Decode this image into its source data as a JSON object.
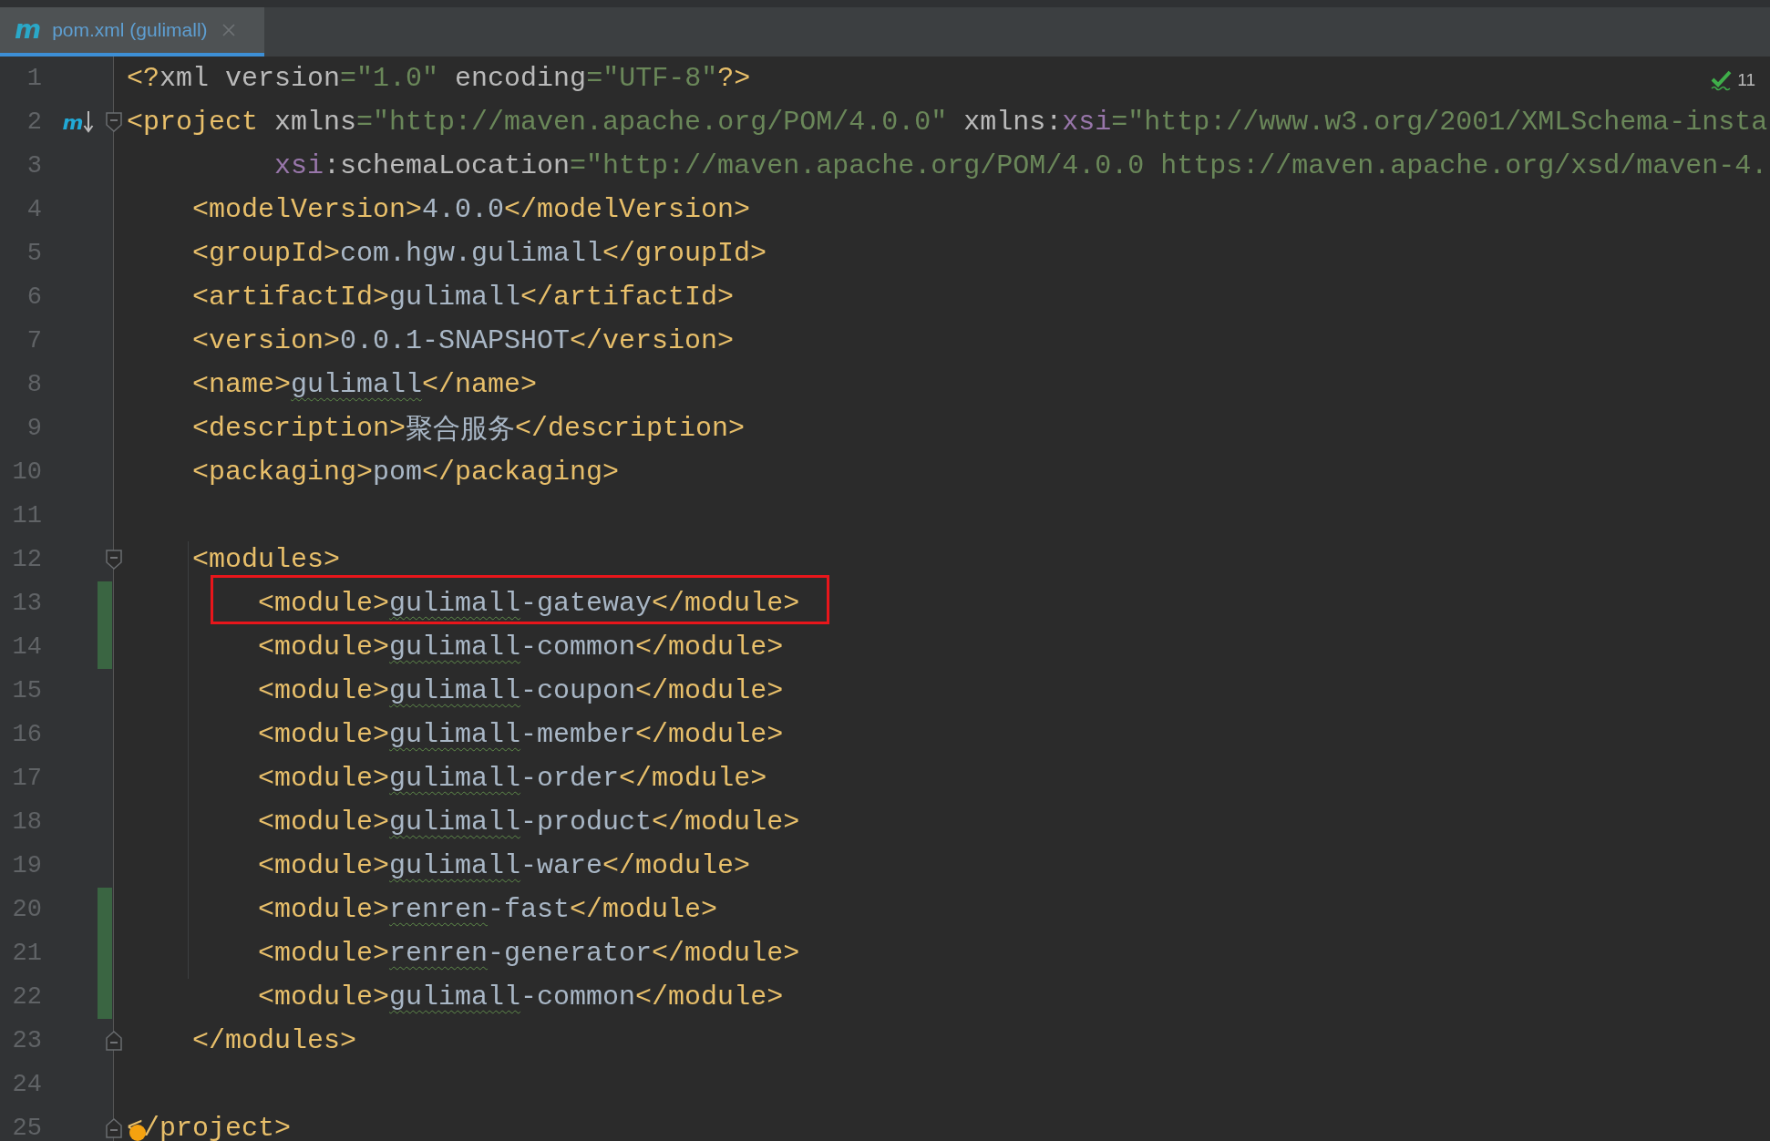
{
  "tab": {
    "icon": "m",
    "label": "pom.xml (gulimall)",
    "selected": true
  },
  "inspections": {
    "count": "11"
  },
  "lines": [
    {
      "number": "1",
      "changed": false,
      "highlighted": false,
      "dot": false,
      "fold_start": false,
      "fold_end": false,
      "tokens": [
        {
          "kind": "tag",
          "text": "<?"
        },
        {
          "kind": "attr",
          "text": "xml version"
        },
        {
          "kind": "value",
          "text": "=\"1.0\""
        },
        {
          "kind": "attr",
          "text": " encoding"
        },
        {
          "kind": "value",
          "text": "=\"UTF-8\""
        },
        {
          "kind": "tag",
          "text": "?>"
        }
      ]
    },
    {
      "number": "2",
      "changed": false,
      "highlighted": false,
      "dot": false,
      "fold_start": true,
      "fold_end": false,
      "gutter_mark": "m",
      "tokens": [
        {
          "kind": "tag",
          "text": "<project"
        },
        {
          "kind": "attr",
          "text": " xmlns"
        },
        {
          "kind": "value",
          "text": "=\"http://maven.apache.org/POM/4.0.0\""
        },
        {
          "kind": "attr",
          "text": " xmlns:"
        },
        {
          "kind": "ns",
          "text": "xsi"
        },
        {
          "kind": "value",
          "text": "=\"http://www.w3.org/2001/XMLSchema-insta"
        }
      ]
    },
    {
      "number": "3",
      "changed": false,
      "highlighted": false,
      "dot": false,
      "fold_start": false,
      "fold_end": false,
      "tokens": [
        {
          "kind": "ns",
          "text": "         xsi"
        },
        {
          "kind": "attr",
          "text": ":schemaLocation"
        },
        {
          "kind": "value",
          "text": "=\"http://maven.apache.org/POM/4.0.0 https://maven.apache.org/xsd/maven-4."
        }
      ]
    },
    {
      "number": "4",
      "changed": false,
      "highlighted": false,
      "dot": false,
      "fold_start": false,
      "fold_end": false,
      "tokens": [
        {
          "kind": "tag",
          "text": "    <modelVersion>"
        },
        {
          "kind": "text",
          "text": "4.0.0"
        },
        {
          "kind": "tag",
          "text": "</modelVersion>"
        }
      ]
    },
    {
      "number": "5",
      "changed": false,
      "highlighted": false,
      "dot": false,
      "fold_start": false,
      "fold_end": false,
      "tokens": [
        {
          "kind": "tag",
          "text": "    <groupId>"
        },
        {
          "kind": "text",
          "text": "com.hgw.gulimall"
        },
        {
          "kind": "tag",
          "text": "</groupId>"
        }
      ]
    },
    {
      "number": "6",
      "changed": false,
      "highlighted": false,
      "dot": false,
      "fold_start": false,
      "fold_end": false,
      "tokens": [
        {
          "kind": "tag",
          "text": "    <artifactId>"
        },
        {
          "kind": "text",
          "text": "gulimall"
        },
        {
          "kind": "tag",
          "text": "</artifactId>"
        }
      ]
    },
    {
      "number": "7",
      "changed": false,
      "highlighted": false,
      "dot": false,
      "fold_start": false,
      "fold_end": false,
      "tokens": [
        {
          "kind": "tag",
          "text": "    <version>"
        },
        {
          "kind": "text",
          "text": "0.0.1-SNAPSHOT"
        },
        {
          "kind": "tag",
          "text": "</version>"
        }
      ]
    },
    {
      "number": "8",
      "changed": false,
      "highlighted": false,
      "dot": false,
      "fold_start": false,
      "fold_end": false,
      "tokens": [
        {
          "kind": "tag",
          "text": "    <name>"
        },
        {
          "kind": "typo",
          "text": "gulimall"
        },
        {
          "kind": "tag",
          "text": "</name>"
        }
      ]
    },
    {
      "number": "9",
      "changed": false,
      "highlighted": false,
      "dot": false,
      "fold_start": false,
      "fold_end": false,
      "tokens": [
        {
          "kind": "tag",
          "text": "    <description>"
        },
        {
          "kind": "text",
          "text": "聚合服务"
        },
        {
          "kind": "tag",
          "text": "</description>"
        }
      ]
    },
    {
      "number": "10",
      "changed": false,
      "highlighted": false,
      "dot": false,
      "fold_start": false,
      "fold_end": false,
      "tokens": [
        {
          "kind": "tag",
          "text": "    <packaging>"
        },
        {
          "kind": "text",
          "text": "pom"
        },
        {
          "kind": "tag",
          "text": "</packaging>"
        }
      ]
    },
    {
      "number": "11",
      "changed": false,
      "highlighted": false,
      "dot": false,
      "fold_start": false,
      "fold_end": false
    },
    {
      "number": "12",
      "changed": false,
      "highlighted": false,
      "dot": false,
      "fold_start": true,
      "fold_end": false,
      "tokens": [
        {
          "kind": "tag",
          "text": "    <modules>"
        }
      ]
    },
    {
      "number": "13",
      "changed": true,
      "highlighted": true,
      "dot": false,
      "fold_start": false,
      "fold_end": false,
      "tokens": [
        {
          "kind": "tag",
          "text": "        <module>"
        },
        {
          "kind": "typo",
          "text": "gulimall"
        },
        {
          "kind": "text",
          "text": "-gateway"
        },
        {
          "kind": "tag",
          "text": "</module>"
        }
      ]
    },
    {
      "number": "14",
      "changed": true,
      "highlighted": false,
      "dot": false,
      "fold_start": false,
      "fold_end": false,
      "tokens": [
        {
          "kind": "tag",
          "text": "        <module>"
        },
        {
          "kind": "typo",
          "text": "gulimall"
        },
        {
          "kind": "text",
          "text": "-common"
        },
        {
          "kind": "tag",
          "text": "</module>"
        }
      ]
    },
    {
      "number": "15",
      "changed": false,
      "highlighted": false,
      "dot": false,
      "fold_start": false,
      "fold_end": false,
      "tokens": [
        {
          "kind": "tag",
          "text": "        <module>"
        },
        {
          "kind": "typo",
          "text": "gulimall"
        },
        {
          "kind": "text",
          "text": "-coupon"
        },
        {
          "kind": "tag",
          "text": "</module>"
        }
      ]
    },
    {
      "number": "16",
      "changed": false,
      "highlighted": false,
      "dot": false,
      "fold_start": false,
      "fold_end": false,
      "tokens": [
        {
          "kind": "tag",
          "text": "        <module>"
        },
        {
          "kind": "typo",
          "text": "gulimall"
        },
        {
          "kind": "text",
          "text": "-member"
        },
        {
          "kind": "tag",
          "text": "</module>"
        }
      ]
    },
    {
      "number": "17",
      "changed": false,
      "highlighted": false,
      "dot": false,
      "fold_start": false,
      "fold_end": false,
      "tokens": [
        {
          "kind": "tag",
          "text": "        <module>"
        },
        {
          "kind": "typo",
          "text": "gulimall"
        },
        {
          "kind": "text",
          "text": "-order"
        },
        {
          "kind": "tag",
          "text": "</module>"
        }
      ]
    },
    {
      "number": "18",
      "changed": false,
      "highlighted": false,
      "dot": false,
      "fold_start": false,
      "fold_end": false,
      "tokens": [
        {
          "kind": "tag",
          "text": "        <module>"
        },
        {
          "kind": "typo",
          "text": "gulimall"
        },
        {
          "kind": "text",
          "text": "-product"
        },
        {
          "kind": "tag",
          "text": "</module>"
        }
      ]
    },
    {
      "number": "19",
      "changed": false,
      "highlighted": false,
      "dot": false,
      "fold_start": false,
      "fold_end": false,
      "tokens": [
        {
          "kind": "tag",
          "text": "        <module>"
        },
        {
          "kind": "typo",
          "text": "gulimall"
        },
        {
          "kind": "text",
          "text": "-ware"
        },
        {
          "kind": "tag",
          "text": "</module>"
        }
      ]
    },
    {
      "number": "20",
      "changed": true,
      "highlighted": false,
      "dot": false,
      "fold_start": false,
      "fold_end": false,
      "tokens": [
        {
          "kind": "tag",
          "text": "        <module>"
        },
        {
          "kind": "typo",
          "text": "renren"
        },
        {
          "kind": "text",
          "text": "-fast"
        },
        {
          "kind": "tag",
          "text": "</module>"
        }
      ]
    },
    {
      "number": "21",
      "changed": true,
      "highlighted": false,
      "dot": false,
      "fold_start": false,
      "fold_end": false,
      "tokens": [
        {
          "kind": "tag",
          "text": "        <module>"
        },
        {
          "kind": "typo",
          "text": "renren"
        },
        {
          "kind": "text",
          "text": "-generator"
        },
        {
          "kind": "tag",
          "text": "</module>"
        }
      ]
    },
    {
      "number": "22",
      "changed": true,
      "highlighted": false,
      "dot": false,
      "fold_start": false,
      "fold_end": false,
      "tokens": [
        {
          "kind": "tag",
          "text": "        <module>"
        },
        {
          "kind": "typo",
          "text": "gulimall"
        },
        {
          "kind": "text",
          "text": "-common"
        },
        {
          "kind": "tag",
          "text": "</module>"
        }
      ]
    },
    {
      "number": "23",
      "changed": false,
      "highlighted": false,
      "dot": false,
      "fold_start": false,
      "fold_end": true,
      "tokens": [
        {
          "kind": "tag",
          "text": "    </modules>"
        }
      ]
    },
    {
      "number": "24",
      "changed": false,
      "highlighted": false,
      "dot": false,
      "fold_start": false,
      "fold_end": false
    },
    {
      "number": "25",
      "changed": false,
      "highlighted": false,
      "dot": true,
      "fold_start": false,
      "fold_end": true,
      "tokens": [
        {
          "kind": "tag",
          "text": "</project>"
        }
      ]
    }
  ]
}
